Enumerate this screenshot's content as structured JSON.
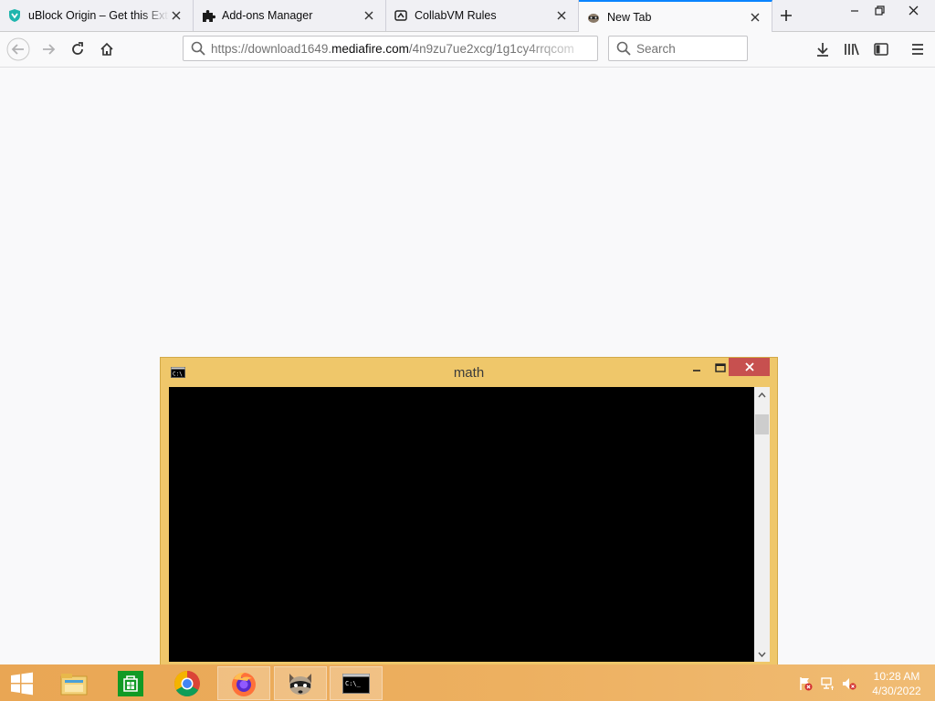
{
  "browser": {
    "tabs": [
      {
        "title": "uBlock Origin – Get this Exte",
        "icon": "ublock-icon",
        "selected": false
      },
      {
        "title": "Add-ons Manager",
        "icon": "puzzle-icon",
        "selected": false
      },
      {
        "title": "CollabVM Rules",
        "icon": "collabvm-icon",
        "selected": false
      },
      {
        "title": "New Tab",
        "icon": "raccoon-icon",
        "selected": true
      }
    ],
    "url_prefix": "https://download1649.",
    "url_domain": "mediafire.com",
    "url_path": "/4n9zu7ue2xcg/1g1cy4rrqcom",
    "search_placeholder": "Search"
  },
  "console_window": {
    "title": "math"
  },
  "taskbar": {
    "start_icon": "windows-logo-icon",
    "pinned": [
      "file-explorer-icon",
      "store-icon",
      "chrome-icon",
      "firefox-icon",
      "raccoon-icon",
      "cmd-icon"
    ],
    "clock_time": "10:28 AM",
    "clock_date": "4/30/2022"
  },
  "colors": {
    "accent_tab": "#0a84ff",
    "console_frame": "#efc76a",
    "close_red": "#c7504f",
    "taskbar": "#eca855"
  }
}
